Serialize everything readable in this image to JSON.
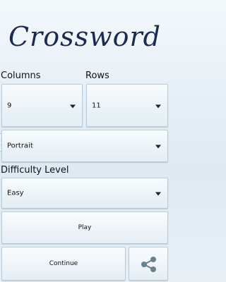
{
  "app": {
    "title": "Crossword"
  },
  "labels": {
    "columns": "Columns",
    "rows": "Rows",
    "difficulty": "Difficulty Level"
  },
  "selects": {
    "columns_value": "9",
    "rows_value": "11",
    "orientation_value": "Portrait",
    "difficulty_value": "Easy"
  },
  "buttons": {
    "play": "Play",
    "continue": "Continue",
    "share_icon": "share-icon"
  },
  "colors": {
    "title": "#1b2a4d",
    "background": "#e6eff6"
  }
}
